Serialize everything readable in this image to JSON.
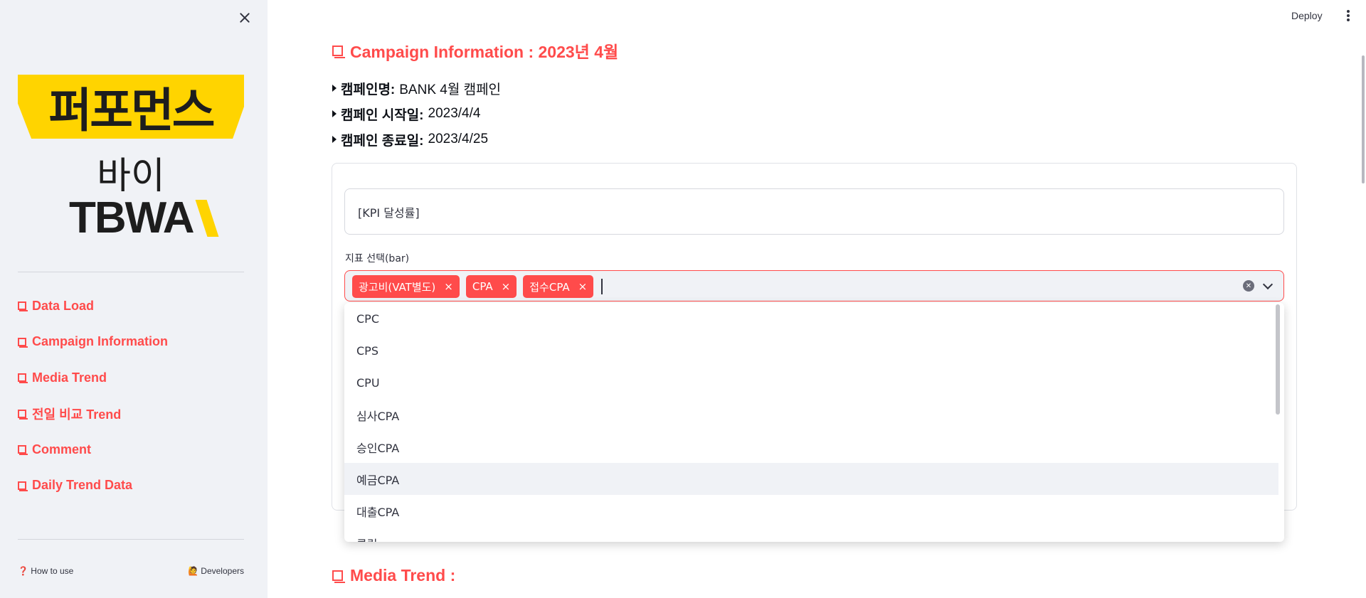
{
  "sidebar": {
    "logo": {
      "top": "퍼포먼스",
      "middle": "바이",
      "bottom": "TBWA"
    },
    "nav": [
      {
        "label": "Data Load"
      },
      {
        "label": "Campaign Information"
      },
      {
        "label": "Media Trend"
      },
      {
        "label": "전일 비교 Trend"
      },
      {
        "label": "Comment"
      },
      {
        "label": "Daily Trend Data"
      }
    ],
    "footer": {
      "how_to_use": "❓ How to use",
      "developers": "🙋 Developers"
    }
  },
  "header": {
    "deploy_label": "Deploy"
  },
  "main": {
    "campaign_title": "Campaign Information : 2023년 4월",
    "info": [
      {
        "key": "캠페인명:",
        "value": "BANK 4월 캠페인"
      },
      {
        "key": "캠페인 시작일:",
        "value": "2023/4/4"
      },
      {
        "key": "캠페인 종료일:",
        "value": "2023/4/25"
      }
    ],
    "kpi_text": "[KPI 달성률]",
    "select_label": "지표 선택(bar)",
    "selected_tags": [
      "광고비(VAT별도)",
      "CPA",
      "접수CPA"
    ],
    "options": [
      "CPC",
      "CPS",
      "CPU",
      "심사CPA",
      "승인CPA",
      "예금CPA",
      "대출CPA",
      "클릭"
    ],
    "highlighted_option": "예금CPA",
    "media_title": "Media Trend :"
  },
  "colors": {
    "accent": "#ff4b4b",
    "sidebar_bg": "#f0f2f6",
    "logo_yellow": "#ffd400"
  }
}
